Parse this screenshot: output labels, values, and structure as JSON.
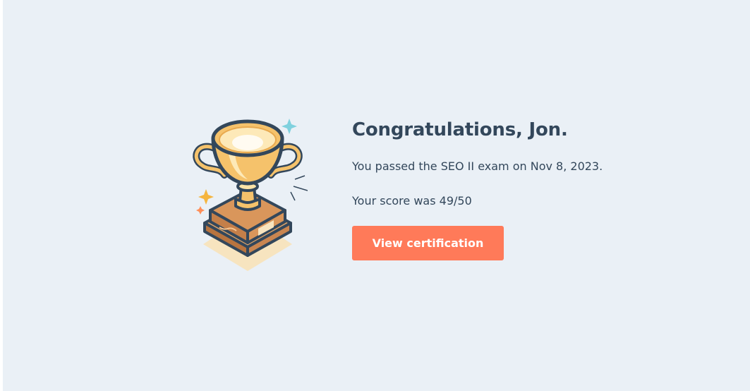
{
  "congrats": {
    "title": "Congratulations, Jon.",
    "passed_text": "You passed the SEO II exam on Nov 8, 2023.",
    "score_text": "Your score was 49/50",
    "button_label": "View certification"
  },
  "icons": {
    "trophy": "trophy-icon",
    "sparkle": "sparkle-icon"
  },
  "colors": {
    "background": "#eaf0f6",
    "text": "#33475b",
    "button": "#ff7a59",
    "button_text": "#ffffff",
    "trophy_gold": "#f5c26b",
    "trophy_base": "#d9965b",
    "sparkle_blue": "#7fd1de",
    "sparkle_orange": "#ff8f59",
    "sparkle_yellow": "#f5c26b"
  }
}
